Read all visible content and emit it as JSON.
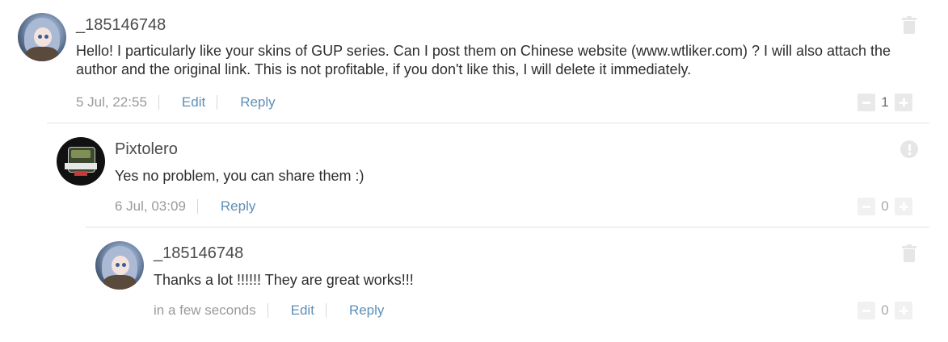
{
  "comments": [
    {
      "author": "_185146748",
      "text": "Hello! I particularly like your skins of GUP series. Can I post them on Chinese website (www.wtliker.com) ? I will also attach the author and the original link. This is not profitable, if you don't like this, I will delete it immediately.",
      "time": "5 Jul, 22:55",
      "edit_label": "Edit",
      "reply_label": "Reply",
      "votes": "1",
      "avatar_icon": "anime-girl-avatar",
      "action_icon": "trash-icon"
    },
    {
      "author": "Pixtolero",
      "text": "Yes no problem, you can share them :)",
      "time": "6 Jul, 03:09",
      "reply_label": "Reply",
      "votes": "0",
      "avatar_icon": "tank-badge-avatar",
      "action_icon": "report-icon"
    },
    {
      "author": "_185146748",
      "text": "Thanks a lot !!!!!! They are great works!!!",
      "time": "in a few seconds",
      "edit_label": "Edit",
      "reply_label": "Reply",
      "votes": "0",
      "avatar_icon": "anime-girl-avatar",
      "action_icon": "trash-icon"
    }
  ],
  "colors": {
    "link": "#5d8fb8",
    "meta": "#9a9a9a",
    "name": "#4a4a4a",
    "icon": "#e6e6e6"
  }
}
